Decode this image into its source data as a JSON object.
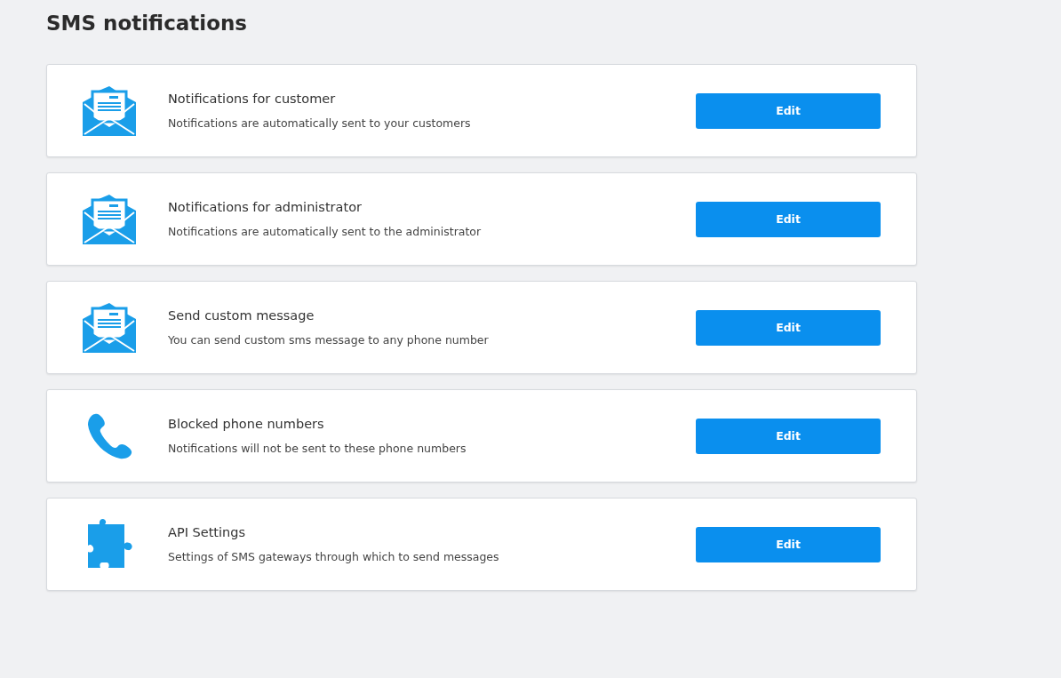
{
  "page": {
    "title": "SMS notifications"
  },
  "cards": [
    {
      "kind": "envelope",
      "title": "Notifications for customer",
      "description": "Notifications are automatically sent to your customers",
      "button": "Edit"
    },
    {
      "kind": "envelope",
      "title": "Notifications for administrator",
      "description": "Notifications are automatically sent to the administrator",
      "button": "Edit"
    },
    {
      "kind": "envelope",
      "title": "Send custom message",
      "description": "You can send custom sms message to any phone number",
      "button": "Edit"
    },
    {
      "kind": "phone",
      "title": "Blocked phone numbers",
      "description": "Notifications will not be sent to these phone numbers",
      "button": "Edit"
    },
    {
      "kind": "puzzle",
      "title": "API Settings",
      "description": "Settings of SMS gateways through which to send messages",
      "button": "Edit"
    }
  ]
}
